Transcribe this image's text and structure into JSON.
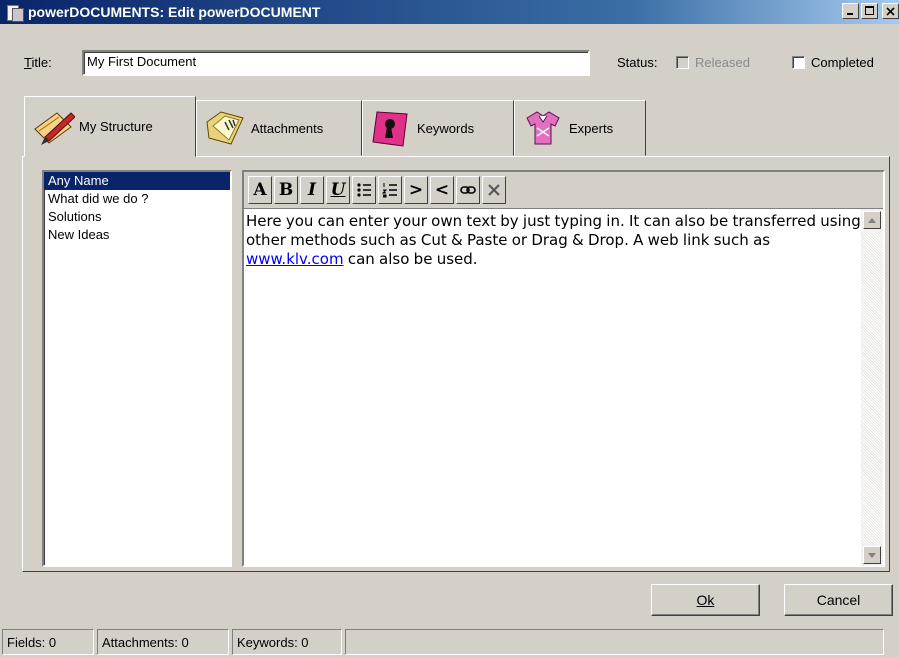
{
  "window": {
    "title": "powerDOCUMENTS: Edit powerDOCUMENT",
    "controls": [
      "minimize",
      "maximize",
      "close"
    ]
  },
  "form": {
    "title_label": "Title:",
    "title_value": "My First Document",
    "status_label": "Status:",
    "released_label": "Released",
    "completed_label": "Completed"
  },
  "tabs": [
    {
      "label": "My Structure",
      "icon": "pencil-paper-icon"
    },
    {
      "label": "Attachments",
      "icon": "folder-icon"
    },
    {
      "label": "Keywords",
      "icon": "keyhole-icon"
    },
    {
      "label": "Experts",
      "icon": "shirt-icon"
    }
  ],
  "structure_list": [
    "Any Name",
    "What did we do ?",
    "Solutions",
    "New Ideas"
  ],
  "selected_item": "Any Name",
  "toolbar": [
    "A",
    "B",
    "I",
    "U",
    "bullet-list",
    "numbered-list",
    ">",
    "<",
    "link",
    "clear"
  ],
  "editor": {
    "text_before": "Here you can enter your own text by just typing in. It can also be transferred using other methods such as Cut & Paste or Drag & Drop. A web link such as ",
    "link": "www.klv.com",
    "text_after": " can also be used."
  },
  "buttons": {
    "ok": "Ok",
    "cancel": "Cancel"
  },
  "status_bar": {
    "fields": "Fields: 0",
    "attachments": "Attachments: 0",
    "keywords": "Keywords: 0"
  },
  "colors": {
    "titlebar": "#0a246a",
    "selection": "#0a246a",
    "link": "#0000ff",
    "face": "#d4d0c8"
  }
}
